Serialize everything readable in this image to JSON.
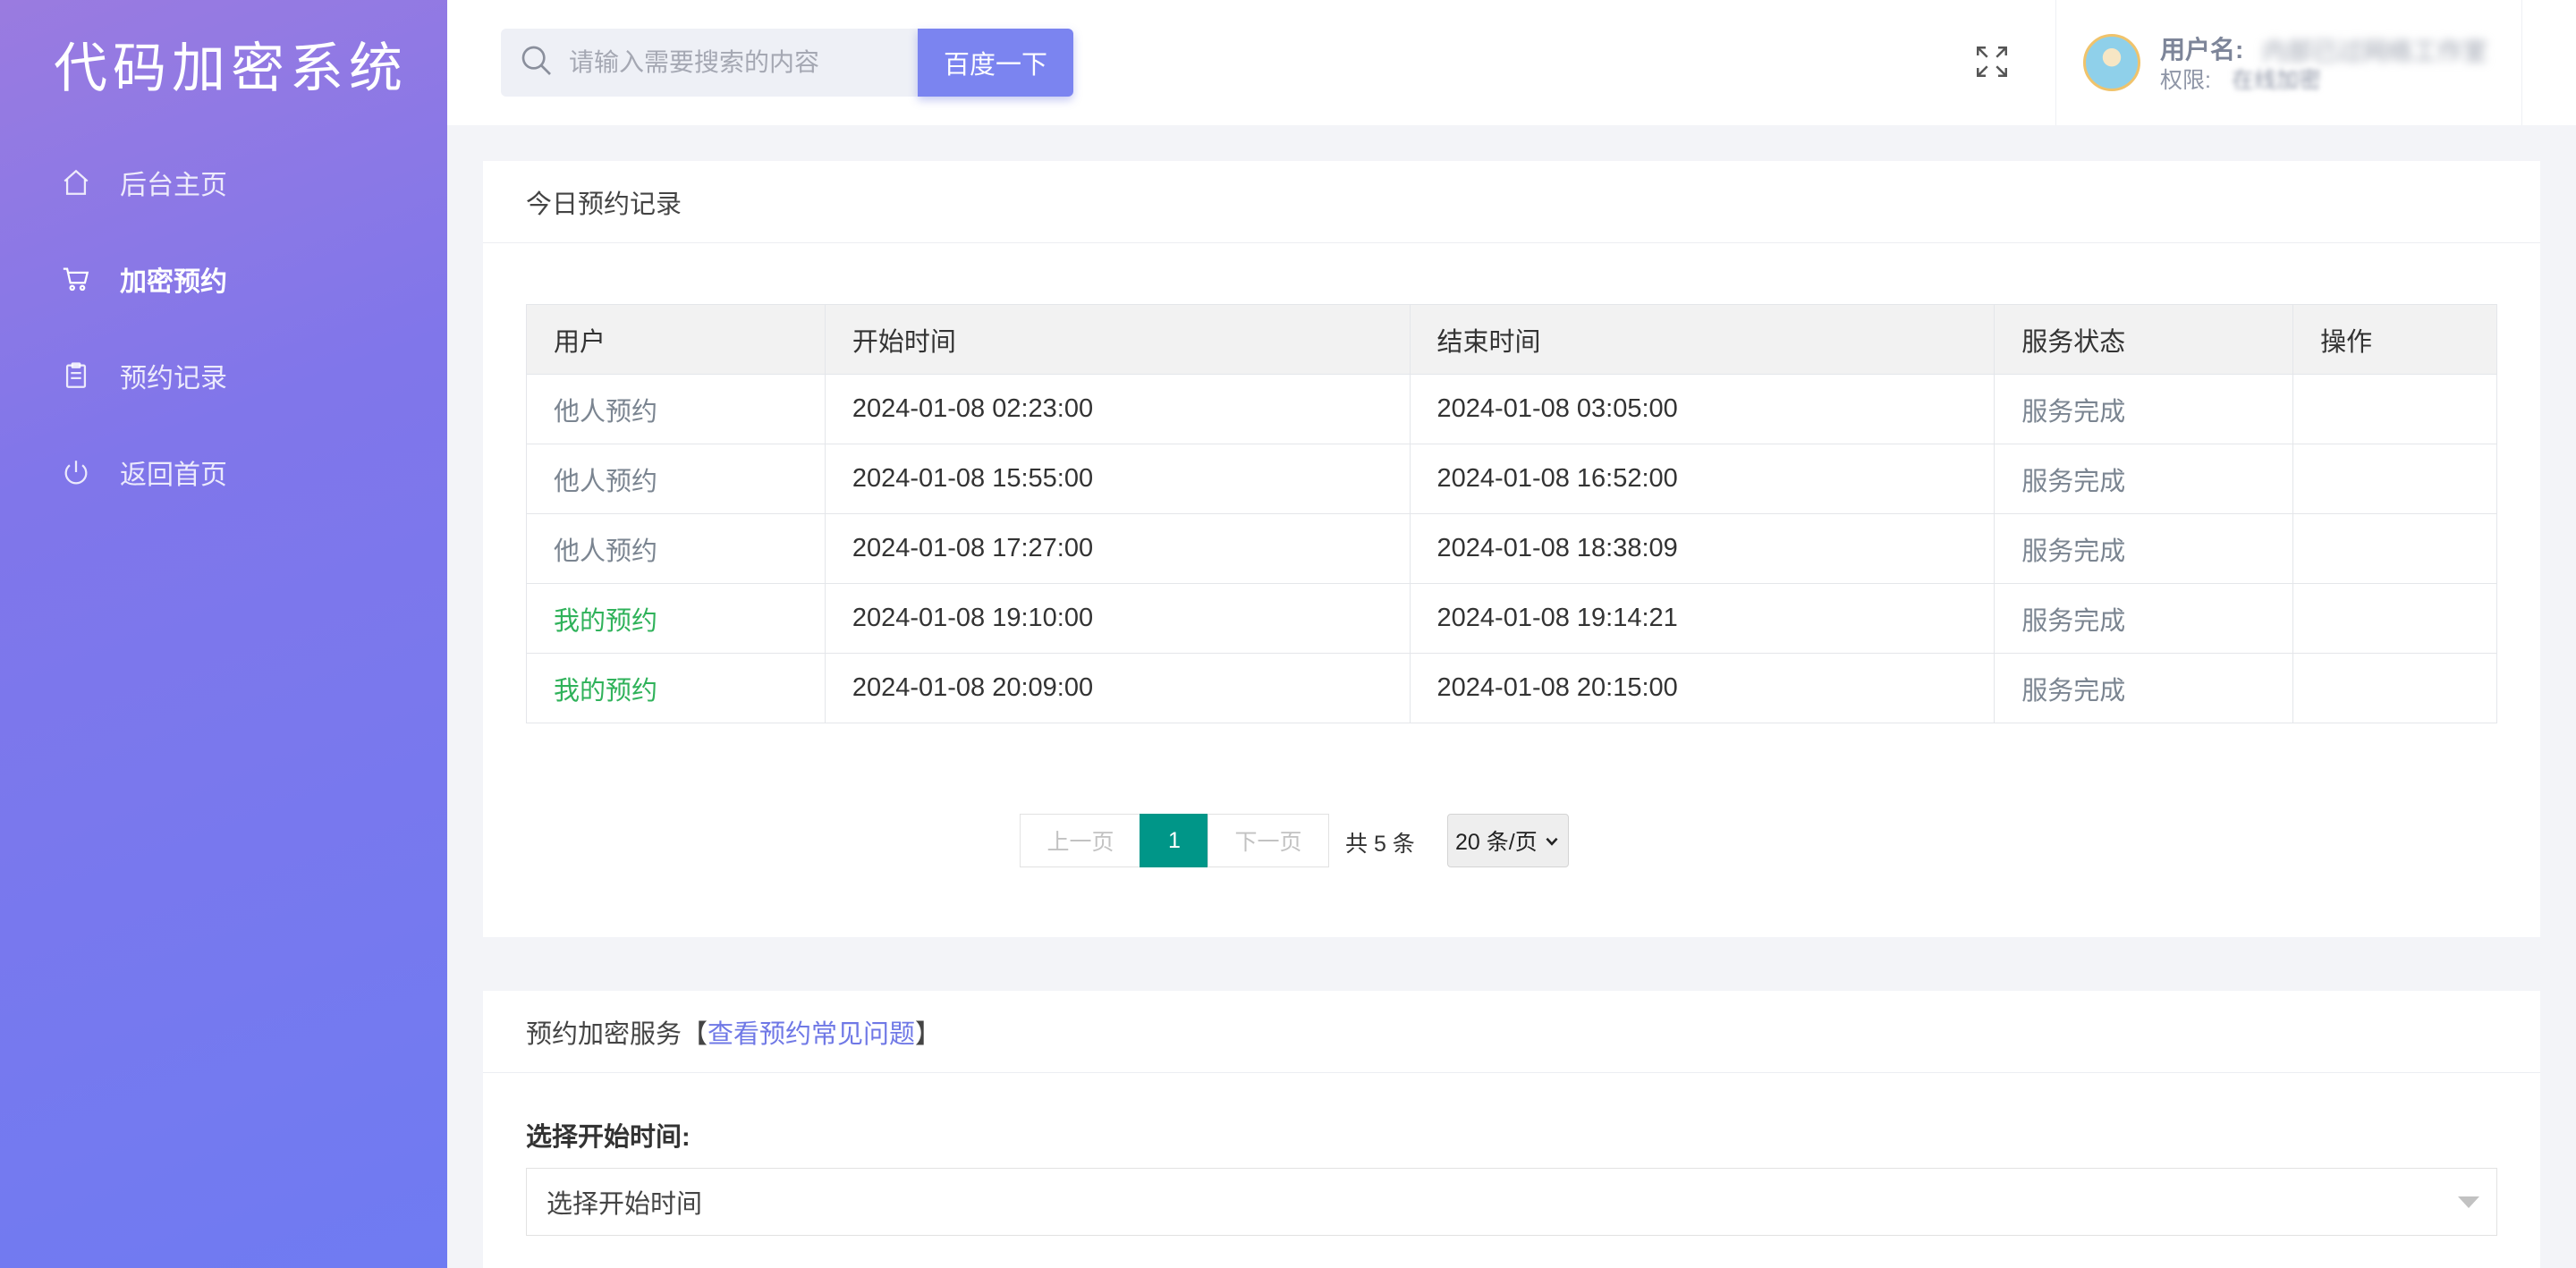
{
  "app": {
    "title": "代码加密系统"
  },
  "sidebar": {
    "items": [
      {
        "label": "后台主页",
        "icon": "home-icon"
      },
      {
        "label": "加密预约",
        "icon": "cart-icon",
        "active": true
      },
      {
        "label": "预约记录",
        "icon": "clipboard-icon"
      },
      {
        "label": "返回首页",
        "icon": "power-icon"
      }
    ]
  },
  "header": {
    "search": {
      "placeholder": "请输入需要搜索的内容",
      "button_label": "百度一下"
    },
    "user": {
      "name_label": "用户名:",
      "name_value": "内部已过网络工作室",
      "role_label": "权限:",
      "role_value": "在线加密"
    }
  },
  "records": {
    "title": "今日预约记录",
    "columns": [
      "用户",
      "开始时间",
      "结束时间",
      "服务状态",
      "操作"
    ],
    "rows": [
      {
        "user": "他人预约",
        "start": "2024-01-08 02:23:00",
        "end": "2024-01-08 03:05:00",
        "status": "服务完成",
        "action": ""
      },
      {
        "user": "他人预约",
        "start": "2024-01-08 15:55:00",
        "end": "2024-01-08 16:52:00",
        "status": "服务完成",
        "action": ""
      },
      {
        "user": "他人预约",
        "start": "2024-01-08 17:27:00",
        "end": "2024-01-08 18:38:09",
        "status": "服务完成",
        "action": ""
      },
      {
        "user": "我的预约",
        "start": "2024-01-08 19:10:00",
        "end": "2024-01-08 19:14:21",
        "status": "服务完成",
        "action": ""
      },
      {
        "user": "我的预约",
        "start": "2024-01-08 20:09:00",
        "end": "2024-01-08 20:15:00",
        "status": "服务完成",
        "action": ""
      }
    ],
    "pagination": {
      "prev_label": "上一页",
      "current_page": "1",
      "next_label": "下一页",
      "total_label": "共 5 条",
      "page_size_label": "20 条/页"
    }
  },
  "booking": {
    "title_prefix": "预约加密服务【",
    "title_link": "查看预约常见问题",
    "title_suffix": "】",
    "start_time_label": "选择开始时间:",
    "start_time_placeholder": "选择开始时间"
  },
  "colors": {
    "sidebar_gradient_start": "#9a7be0",
    "sidebar_gradient_end": "#6f7bf2",
    "accent": "#7b84f0",
    "page_current": "#009688",
    "mine_user": "#2fb25a"
  }
}
